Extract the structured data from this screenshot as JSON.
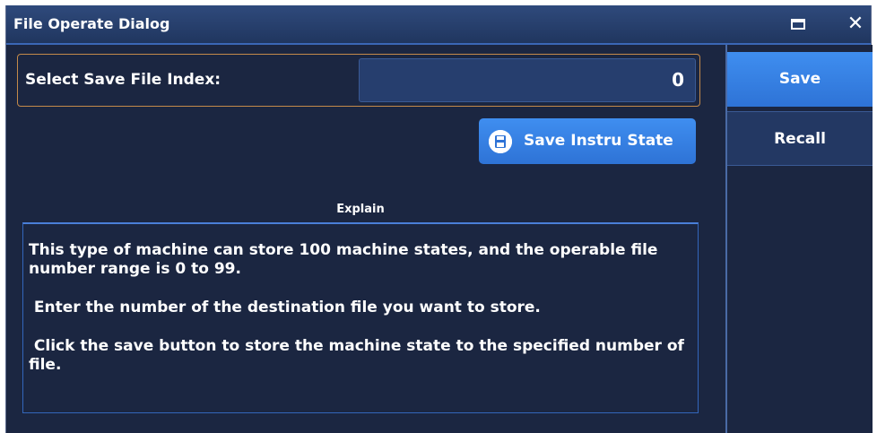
{
  "window": {
    "title": "File Operate Dialog"
  },
  "form": {
    "index_label": "Select Save File Index:",
    "index_value": "0",
    "save_state_button": "Save Instru State"
  },
  "explain": {
    "caption": "Explain",
    "paragraphs": [
      "This type of machine can store 100 machine states, and the operable file number range is 0 to 99.",
      " Enter the number of the destination file you want to store.",
      " Click the save button to store the machine state to the specified number of file."
    ]
  },
  "sidebar": {
    "items": [
      {
        "label": "Save"
      },
      {
        "label": "Recall"
      }
    ]
  },
  "colors": {
    "background": "#1b2641",
    "accent": "#3a83e6",
    "input_border": "#c48a4a"
  }
}
